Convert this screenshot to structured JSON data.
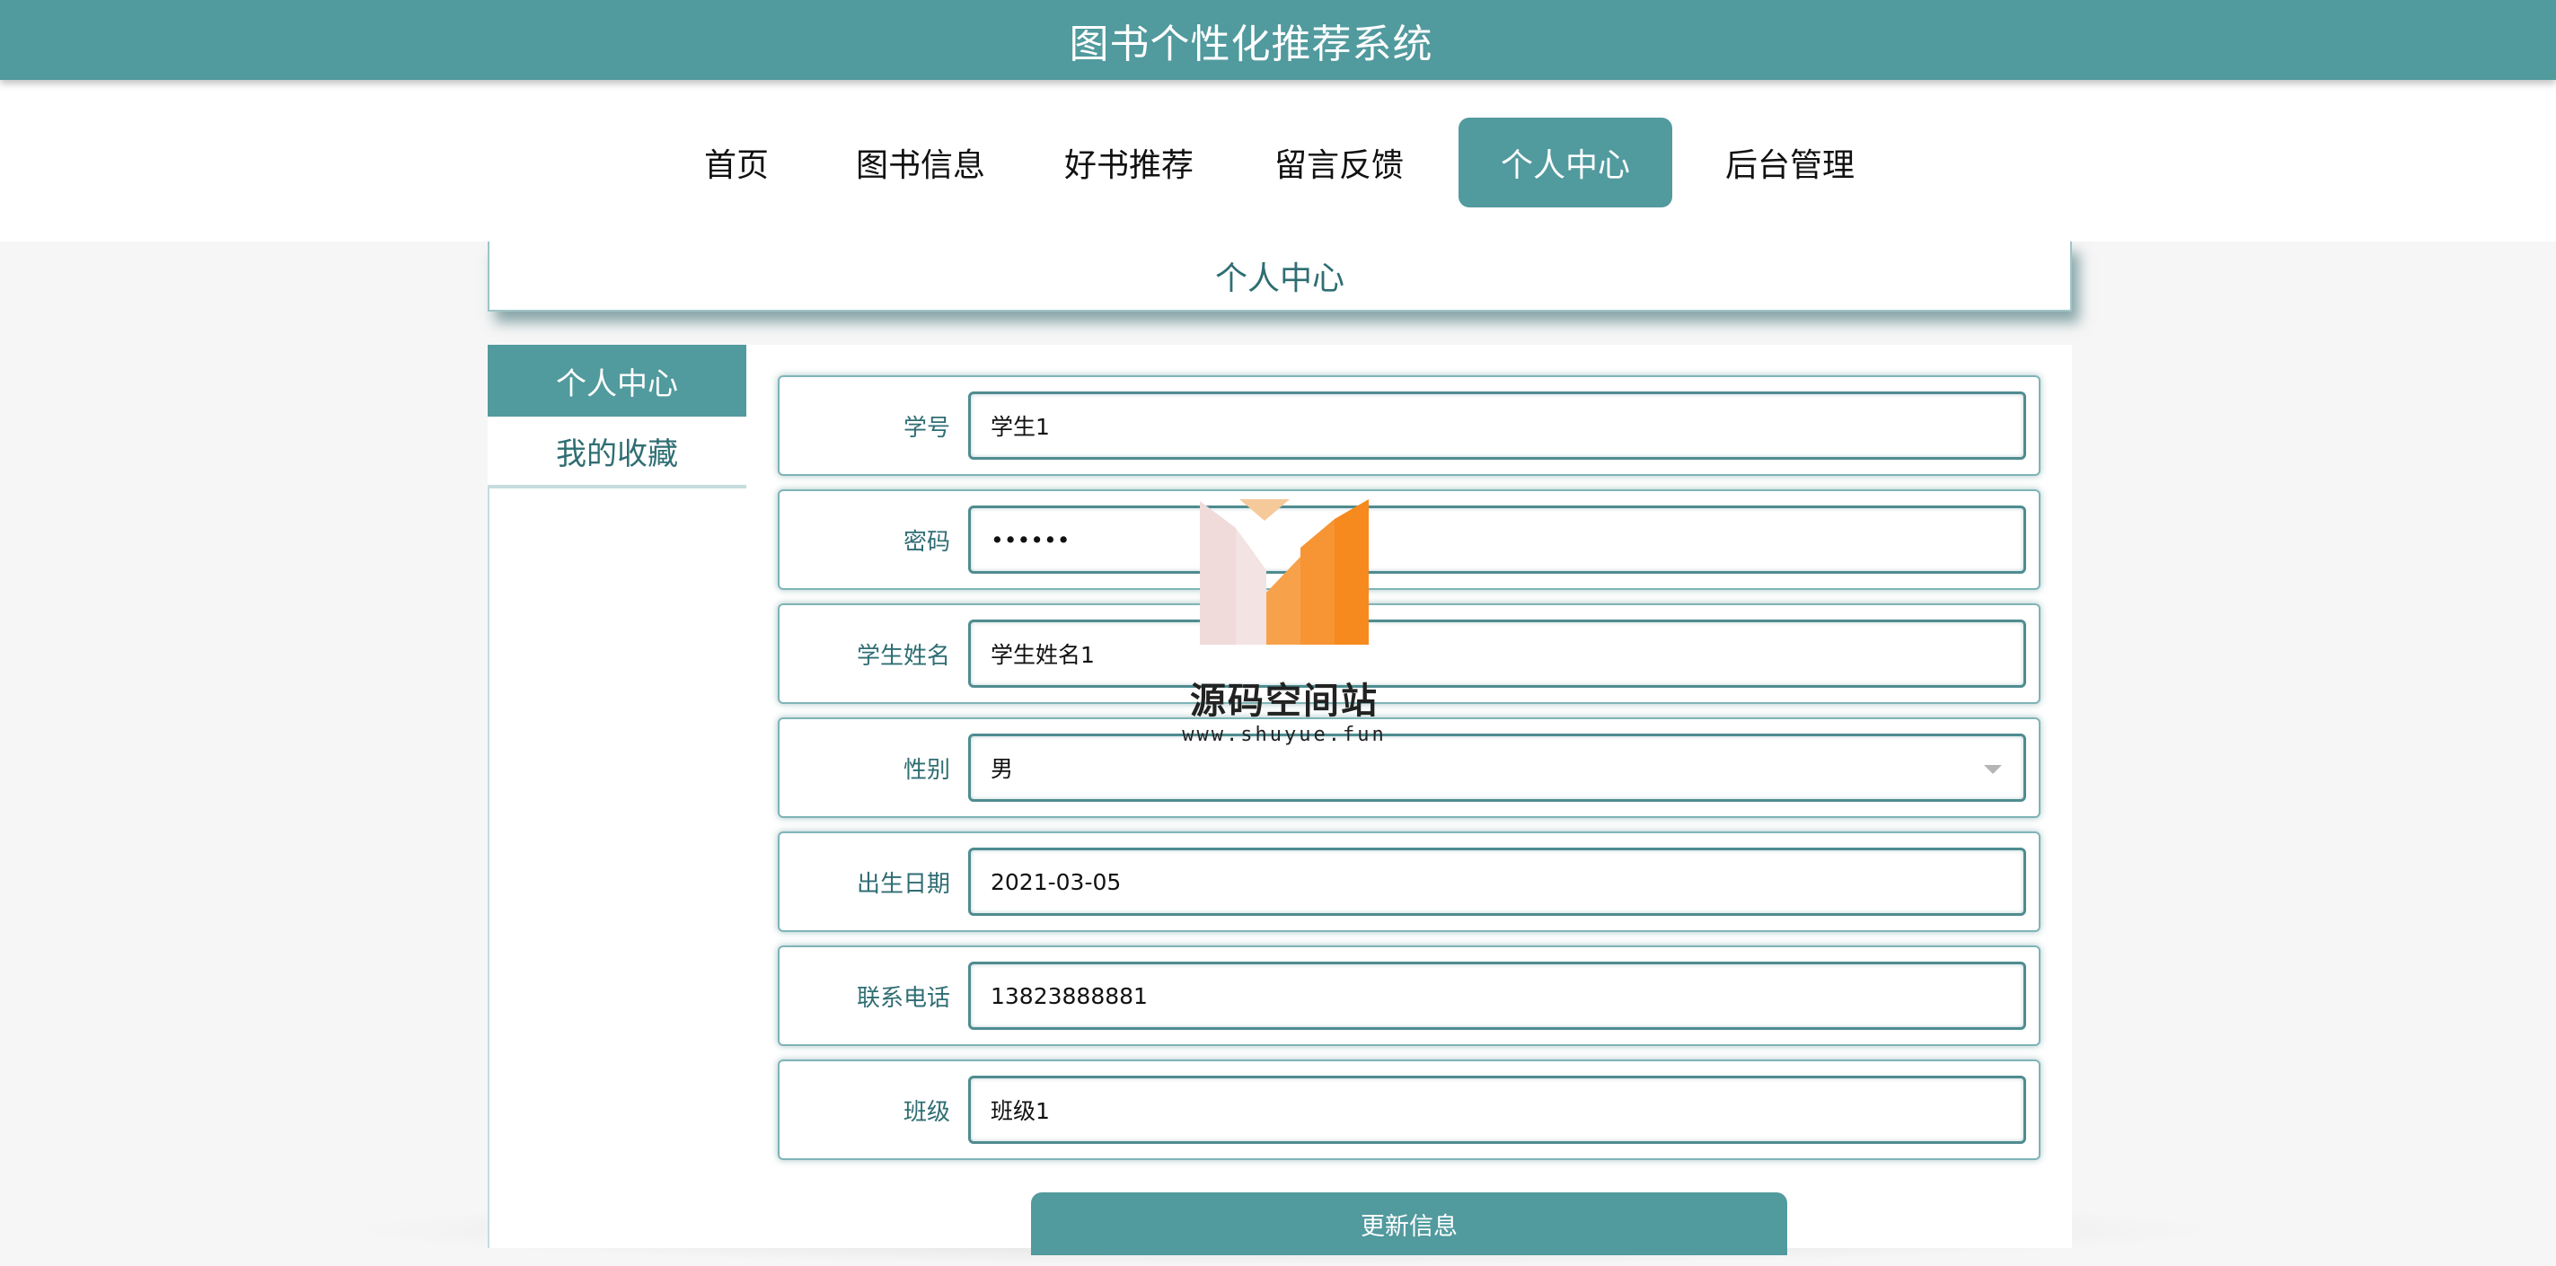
{
  "app": {
    "title": "图书个性化推荐系统"
  },
  "nav": {
    "items": [
      {
        "label": "首页"
      },
      {
        "label": "图书信息"
      },
      {
        "label": "好书推荐"
      },
      {
        "label": "留言反馈"
      },
      {
        "label": "个人中心",
        "active": true
      },
      {
        "label": "后台管理"
      }
    ]
  },
  "page": {
    "title": "个人中心"
  },
  "sidebar": {
    "items": [
      {
        "label": "个人中心",
        "active": true
      },
      {
        "label": "我的收藏"
      }
    ]
  },
  "form": {
    "fields": [
      {
        "label": "学号",
        "value": "学生1"
      },
      {
        "label": "密码",
        "value": "••••••"
      },
      {
        "label": "学生姓名",
        "value": "学生姓名1"
      },
      {
        "label": "性别",
        "value": "男"
      },
      {
        "label": "出生日期",
        "value": "2021-03-05"
      },
      {
        "label": "联系电话",
        "value": "13823888881"
      },
      {
        "label": "班级",
        "value": "班级1"
      }
    ],
    "submit_label": "更新信息"
  },
  "watermark": {
    "name": "源码空间站",
    "url": "www.shuyue.fun"
  },
  "colors": {
    "accent": "#519a9e",
    "text_accent": "#2f6e73"
  }
}
